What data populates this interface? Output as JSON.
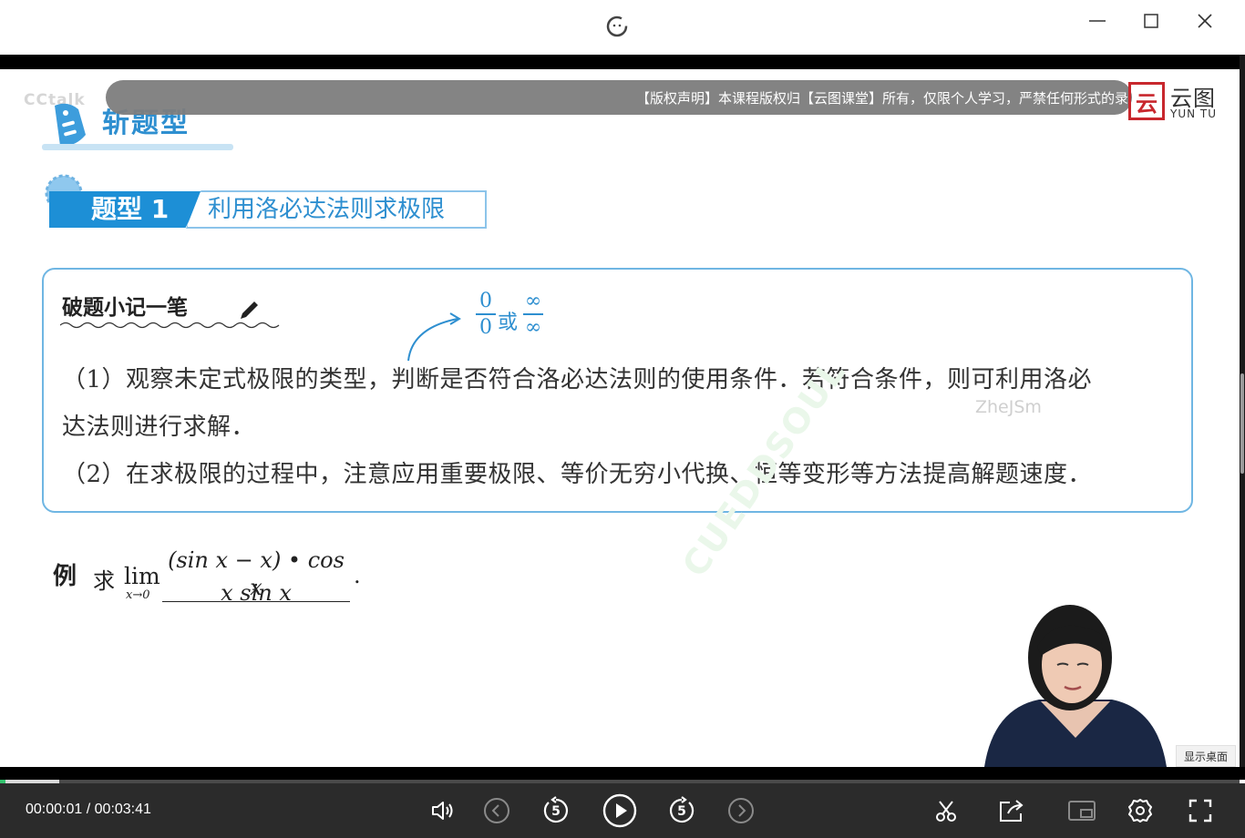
{
  "window": {
    "minimize_icon": "minimize-icon",
    "maximize_icon": "maximize-icon",
    "close_icon": "close-icon"
  },
  "overlay": {
    "copyright_notice": "【版权声明】本课程版权归【云图课堂】所有，仅限个人学习，严禁任何形式的录",
    "faded_logo": "CCtalk",
    "brand_cn": "云图",
    "brand_en": "YUN TU",
    "watermark_user": "ZheJSm",
    "watermark_diag": "CUEDDSOUL",
    "show_desktop": "显示桌面"
  },
  "lesson": {
    "section_title": "斩题型",
    "type_label": "题型 1",
    "type_topic": "利用洛必达法则求极限",
    "notes_title": "破题小记一笔",
    "frac_a_num": "0",
    "frac_a_den": "0",
    "frac_or": "或",
    "frac_b_num": "∞",
    "frac_b_den": "∞",
    "line1": "（1）观察未定式极限的类型，判断是否符合洛必达法则的使用条件．若符合条件，则可利用洛必",
    "line2": "达法则进行求解．",
    "line3": "（2）在求极限的过程中，注意应用重要极限、等价无穷小代换、恒等变形等方法提高解题速度．",
    "example_tag": "例",
    "example_qiu": "求",
    "example_lim": "lim",
    "example_sub": "x→0",
    "example_numerator": "(sin x − x) • cos x",
    "example_denominator": "x sin x",
    "example_end": "."
  },
  "player": {
    "current_time": "00:00:01",
    "separator": "/",
    "total_time": "00:03:41",
    "progress_fraction": 0.0045,
    "buffered_fraction": 0.048,
    "rewind_seconds": "5",
    "forward_seconds": "5",
    "accent_color": "#33c26d"
  }
}
